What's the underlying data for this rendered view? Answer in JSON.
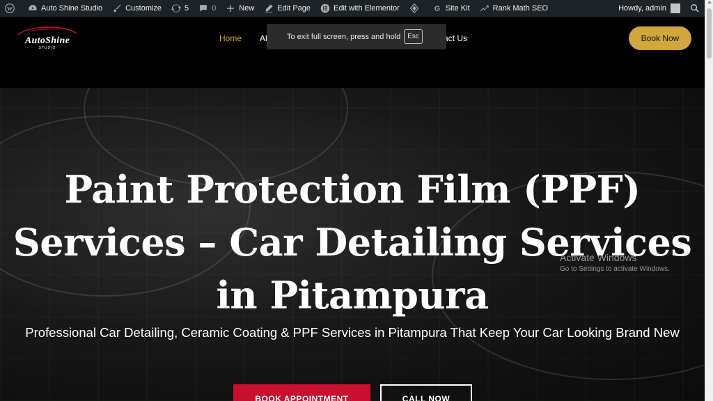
{
  "adminbar": {
    "site_name": "Auto Shine Studio",
    "customize": "Customize",
    "updates_count": "5",
    "comments_count": "0",
    "new": "New",
    "edit_page": "Edit Page",
    "edit_elementor": "Edit with Elementor",
    "site_kit": "Site Kit",
    "rank_math": "Rank Math SEO",
    "howdy": "Howdy, admin"
  },
  "header": {
    "logo_name": "AutoShine",
    "logo_sub": "STUDIO",
    "nav": [
      {
        "label": "Home"
      },
      {
        "label": "Al"
      },
      {
        "label": "act Us"
      }
    ],
    "book_button": "Book Now"
  },
  "fullscreen_toast": {
    "text": "To exit full screen, press and hold",
    "key": "Esc"
  },
  "hero": {
    "title": "Paint Protection Film (PPF) Services – Car Detailing Services in Pitampura",
    "subtitle": "Professional Car Detailing, Ceramic Coating & PPF Services in Pitampura That Keep Your Car Looking Brand New",
    "primary_button": "BOOK APPOINTMENT",
    "secondary_button": "CALL NOW"
  },
  "watermark": {
    "title": "Activate Windows",
    "subtitle": "Go to Settings to activate Windows."
  },
  "colors": {
    "accent_gold": "#d1a63a",
    "nav_active": "#d4a52a",
    "cta_red": "#c8102e",
    "adminbar_bg": "#1d2327"
  }
}
